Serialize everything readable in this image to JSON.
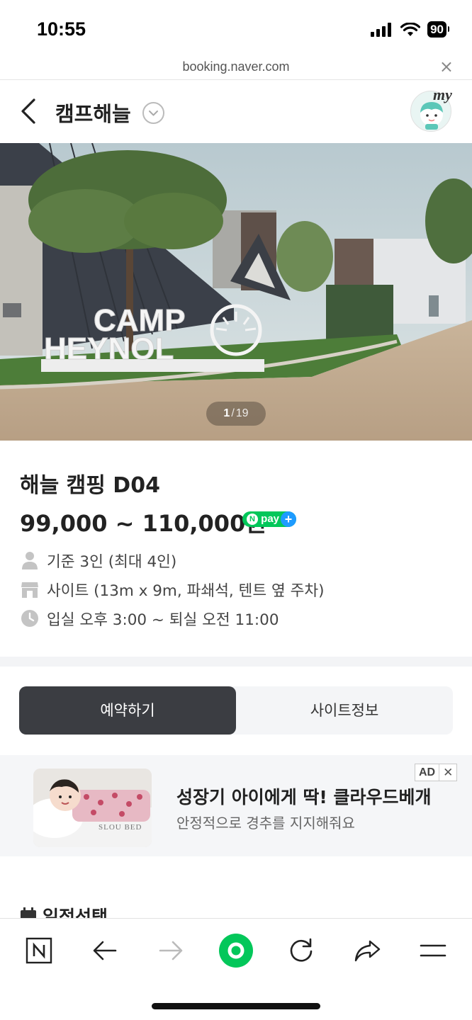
{
  "status": {
    "time": "10:55",
    "battery": "90"
  },
  "browser": {
    "url": "booking.naver.com",
    "close_label": "×"
  },
  "header": {
    "title": "캠프해늘",
    "my_label": "my"
  },
  "hero": {
    "sign_line1": "CAMP",
    "sign_line2": "HEYNOL",
    "counter_current": "1",
    "counter_sep": "/",
    "counter_total": "19"
  },
  "product": {
    "name": "해늘 캠핑 D04",
    "price": "99,000 ~ 110,000원",
    "npay_label": "pay",
    "info": {
      "capacity": "기준 3인 (최대 4인)",
      "site": "사이트 (13m x 9m, 파쇄석, 텐트 옆 주차)",
      "time": "입실 오후 3:00 ~ 퇴실 오전 11:00"
    }
  },
  "tabs": {
    "reserve": "예약하기",
    "site_info": "사이트정보"
  },
  "ad": {
    "badge": "AD",
    "close": "✕",
    "headline": "성장기 아이에게 딱! 클라우드베개",
    "sub": "안정적으로 경추를 지지해줘요",
    "image_brand": "SLOU BED"
  },
  "section": {
    "date_title": "일정선택"
  },
  "toolbar": {
    "icons": [
      "naver-n-icon",
      "back-arrow-icon",
      "forward-arrow-icon",
      "green-dot-icon",
      "refresh-icon",
      "share-icon",
      "menu-icon"
    ]
  },
  "colors": {
    "naver_green": "#03c75a",
    "tab_active": "#3b3d42",
    "npay_plus": "#1e9bff"
  }
}
